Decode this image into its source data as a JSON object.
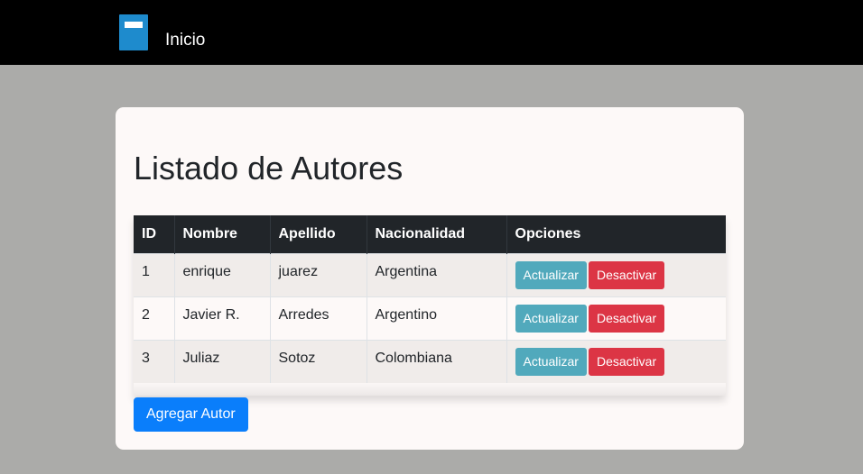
{
  "navbar": {
    "brand_icon": "book-icon",
    "link_label": "Inicio",
    "background": "#000000",
    "logo_color": "#1e8bcd"
  },
  "card": {
    "title": "Listado de Autores"
  },
  "table": {
    "headers": [
      "ID",
      "Nombre",
      "Apellido",
      "Nacionalidad",
      "Opciones"
    ],
    "rows": [
      {
        "id": "1",
        "nombre": "enrique",
        "apellido": "juarez",
        "nacionalidad": "Argentina",
        "update_label": "Actualizar",
        "deactivate_label": "Desactivar"
      },
      {
        "id": "2",
        "nombre": "Javier R.",
        "apellido": "Arredes",
        "nacionalidad": "Argentino",
        "update_label": "Actualizar",
        "deactivate_label": "Desactivar"
      },
      {
        "id": "3",
        "nombre": "Juliaz",
        "apellido": "Sotoz",
        "nacionalidad": "Colombiana",
        "update_label": "Actualizar",
        "deactivate_label": "Desactivar"
      }
    ]
  },
  "add_button": {
    "label": "Agregar Autor"
  },
  "colors": {
    "info_button": "#51a9bc",
    "danger_button": "#dc3545",
    "primary_button": "#0a7efb",
    "table_header": "#212529",
    "page_background": "#ababa9"
  }
}
